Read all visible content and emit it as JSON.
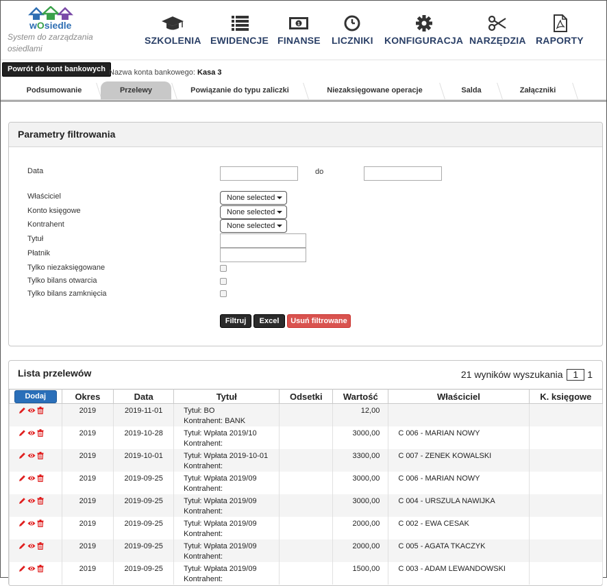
{
  "brand": {
    "logo_text_w": "w",
    "logo_text_o": "O",
    "logo_text_rest": "siedle",
    "tagline": "System do zarządzania osiedlami",
    "colors": {
      "house1": "#2f6fb3",
      "house2": "#3aa14a",
      "house3": "#7a4aa8"
    }
  },
  "nav": [
    {
      "label": "SZKOLENIA",
      "icon": "graduation-cap-icon"
    },
    {
      "label": "EWIDENCJE",
      "icon": "list-icon"
    },
    {
      "label": "FINANSE",
      "icon": "banknote-icon"
    },
    {
      "label": "LICZNIKI",
      "icon": "clock-icon"
    },
    {
      "label": "KONFIGURACJA",
      "icon": "gear-icon"
    },
    {
      "label": "NARZĘDZIA",
      "icon": "scissors-icon"
    },
    {
      "label": "RAPORTY",
      "icon": "pdf-file-icon"
    }
  ],
  "account": {
    "back_label": "Powrót do kont bankowych",
    "name_label": "Nazwa konta bankowego:",
    "name_value": "Kasa 3"
  },
  "tabs": [
    {
      "label": "Podsumowanie",
      "active": false
    },
    {
      "label": "Przelewy",
      "active": true
    },
    {
      "label": "Powiązanie do typu zaliczki",
      "active": false
    },
    {
      "label": "Niezaksięgowane operacje",
      "active": false
    },
    {
      "label": "Salda",
      "active": false
    },
    {
      "label": "Załączniki",
      "active": false
    }
  ],
  "filter": {
    "title": "Parametry filtrowania",
    "date_label": "Data",
    "date_to_label": "do",
    "date_from_value": "",
    "date_to_value": "",
    "owner_label": "Właściciel",
    "account_label": "Konto księgowe",
    "contractor_label": "Kontrahent",
    "title_label": "Tytuł",
    "payer_label": "Płatnik",
    "select_value": "None selected",
    "title_value": "",
    "payer_value": "",
    "only_unbooked_label": "Tylko niezaksięgowane",
    "only_opening_label": "Tylko bilans otwarcia",
    "only_closing_label": "Tylko bilans zamknięcia",
    "filter_btn": "Filtruj",
    "excel_btn": "Excel",
    "clear_btn": "Usuń filtrowane",
    "colors": {
      "danger": "#d9534f"
    }
  },
  "list": {
    "title": "Lista przelewów",
    "results_text": "21 wyników wyszukania",
    "page_current": "1",
    "page_total": "1",
    "add_btn": "Dodaj",
    "columns": [
      "Okres",
      "Data",
      "Tytuł",
      "Odsetki",
      "Wartość",
      "Właściciel",
      "K. księgowe"
    ],
    "rows": [
      {
        "okres": "2019",
        "data": "2019-11-01",
        "tytul": "Tytuł: BO",
        "kontrahent": "Kontrahent: BANK",
        "odsetki": "",
        "wartosc": "12,00",
        "wlasciciel": "",
        "konto": ""
      },
      {
        "okres": "2019",
        "data": "2019-10-28",
        "tytul": "Tytuł: Wpłata 2019/10",
        "kontrahent": "Kontrahent:",
        "odsetki": "",
        "wartosc": "3000,00",
        "wlasciciel": "C 006 - MARIAN NOWY",
        "konto": ""
      },
      {
        "okres": "2019",
        "data": "2019-10-01",
        "tytul": "Tytuł: Wpłata 2019-10-01",
        "kontrahent": "Kontrahent:",
        "odsetki": "",
        "wartosc": "3300,00",
        "wlasciciel": "C 007 - ZENEK KOWALSKI",
        "konto": ""
      },
      {
        "okres": "2019",
        "data": "2019-09-25",
        "tytul": "Tytuł: Wpłata 2019/09",
        "kontrahent": "Kontrahent:",
        "odsetki": "",
        "wartosc": "3000,00",
        "wlasciciel": "C 006 - MARIAN NOWY",
        "konto": ""
      },
      {
        "okres": "2019",
        "data": "2019-09-25",
        "tytul": "Tytuł: Wpłata 2019/09",
        "kontrahent": "Kontrahent:",
        "odsetki": "",
        "wartosc": "3000,00",
        "wlasciciel": "C 004 - URSZULA NAWIJKA",
        "konto": ""
      },
      {
        "okres": "2019",
        "data": "2019-09-25",
        "tytul": "Tytuł: Wpłata 2019/09",
        "kontrahent": "Kontrahent:",
        "odsetki": "",
        "wartosc": "2000,00",
        "wlasciciel": "C 002 - EWA CESAK",
        "konto": ""
      },
      {
        "okres": "2019",
        "data": "2019-09-25",
        "tytul": "Tytuł: Wpłata 2019/09",
        "kontrahent": "Kontrahent:",
        "odsetki": "",
        "wartosc": "2000,00",
        "wlasciciel": "C 005 - AGATA TKACZYK",
        "konto": ""
      },
      {
        "okres": "2019",
        "data": "2019-09-25",
        "tytul": "Tytuł: Wpłata 2019/09",
        "kontrahent": "Kontrahent:",
        "odsetki": "",
        "wartosc": "1500,00",
        "wlasciciel": "C 003 - ADAM LEWANDOWSKI",
        "konto": ""
      }
    ],
    "row_actions": [
      "pencil-icon",
      "eye-icon",
      "trash-icon"
    ],
    "colors": {
      "action": "#e02020",
      "primary": "#2a6fb9"
    }
  }
}
